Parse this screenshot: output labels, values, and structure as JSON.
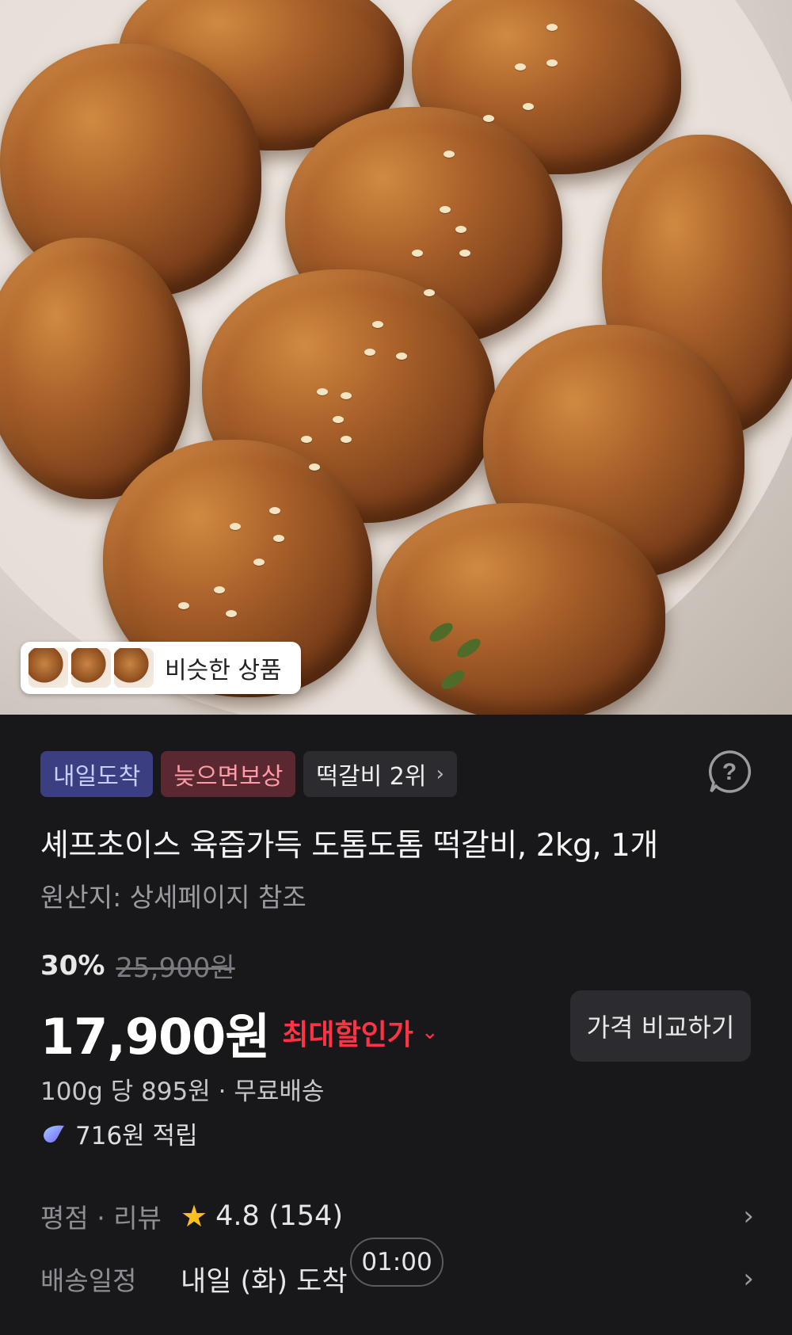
{
  "hero": {
    "image_alt": "product-photo-meatballs",
    "similar_label": "비슷한 상품"
  },
  "badges": {
    "tomorrow": "내일도착",
    "late_comp": "늦으면보상",
    "rank": "떡갈비 2위"
  },
  "product": {
    "title": "셰프초이스 육즙가득 도톰도톰 떡갈비, 2kg, 1개",
    "origin": "원산지: 상세페이지 참조"
  },
  "pricing": {
    "discount": "30%",
    "original_price": "25,900원",
    "price": "17,900원",
    "best_price_label": "최대할인가",
    "compare_button": "가격 비교하기",
    "unit_shipping": "100g 당 895원 · 무료배송",
    "reward": "716원 적립"
  },
  "rating": {
    "label": "평점 · 리뷰",
    "value": "4.8 (154)"
  },
  "delivery": {
    "label": "배송일정",
    "value": "내일 (화) 도착",
    "timer": "01:00"
  },
  "colors": {
    "background": "#18181b",
    "accent_red": "#ff3344",
    "badge_blue": "#3b3e80",
    "badge_red": "#5a2830",
    "star": "#ffc21a"
  },
  "icons": [
    "help-icon",
    "chevron-right-icon",
    "chevron-down-icon",
    "star-icon",
    "reward-gem-icon"
  ]
}
